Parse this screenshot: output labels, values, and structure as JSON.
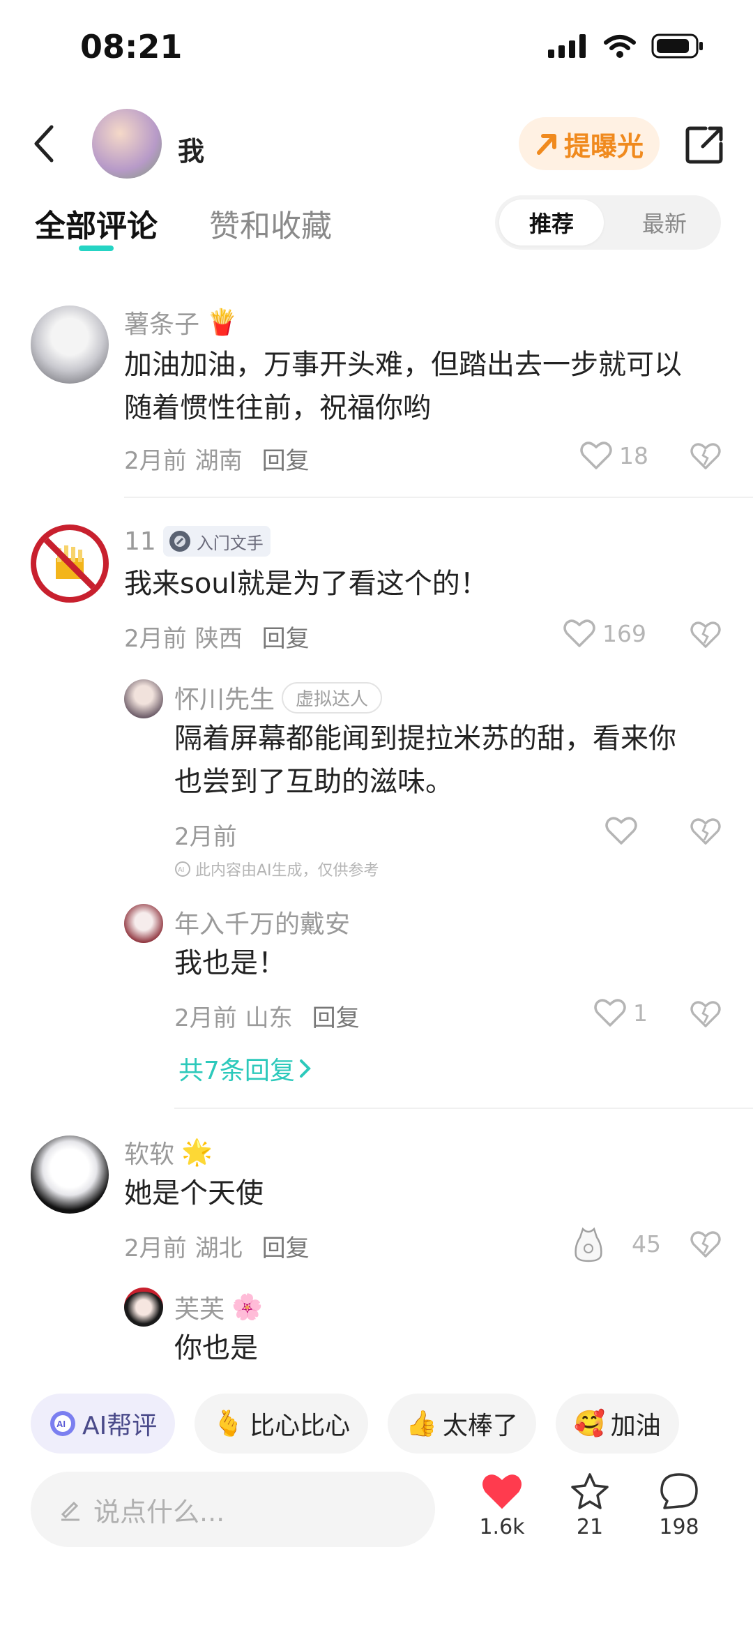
{
  "status": {
    "time": "08:21"
  },
  "header": {
    "name": "我",
    "boost_label": "提曝光"
  },
  "tabs": {
    "all_comments": "全部评论",
    "likes_favs": "赞和收藏"
  },
  "sort": {
    "recommended": "推荐",
    "latest": "最新"
  },
  "comments": [
    {
      "user": "薯条子",
      "emoji": "🍟",
      "text_line1": "加油加油，万事开头难，但踏出去一步就可以",
      "text_line2": "随着惯性往前，祝福你哟",
      "time": "2月前",
      "location": "湖南",
      "reply": "回复",
      "likes": "18"
    },
    {
      "user": "11",
      "badge": "入门文手",
      "text": "我来soul就是为了看这个的！",
      "time": "2月前",
      "location": "陕西",
      "reply": "回复",
      "likes": "169",
      "replies": [
        {
          "user": "怀川先生",
          "badge": "虚拟达人",
          "text_line1": "隔着屏幕都能闻到提拉米苏的甜，看来你",
          "text_line2": "也尝到了互助的滋味。",
          "time": "2月前",
          "ai_note": "此内容由AI生成，仅供参考"
        },
        {
          "user": "年入千万的戴安",
          "text": "我也是！",
          "time": "2月前",
          "location": "山东",
          "reply": "回复",
          "likes": "1"
        }
      ],
      "more": "共7条回复"
    },
    {
      "user": "软软",
      "emoji": "🌟",
      "text": "她是个天使",
      "time": "2月前",
      "location": "湖北",
      "reply": "回复",
      "likes": "45",
      "replies": [
        {
          "user": "芙芙",
          "emoji": "🌸",
          "text": "你也是"
        }
      ]
    }
  ],
  "quick_replies": {
    "ai": "AI帮评",
    "chip1_emoji": "🫰",
    "chip1": "比心比心",
    "chip2_emoji": "👍",
    "chip2": "太棒了",
    "chip3_emoji": "🥰",
    "chip3": "加油"
  },
  "bottom": {
    "placeholder": "说点什么...",
    "likes": "1.6k",
    "stars": "21",
    "comments": "198"
  },
  "colors": {
    "accent": "#25d4c4",
    "boost": "#f08a1e",
    "like_red": "#ff3b4e"
  }
}
